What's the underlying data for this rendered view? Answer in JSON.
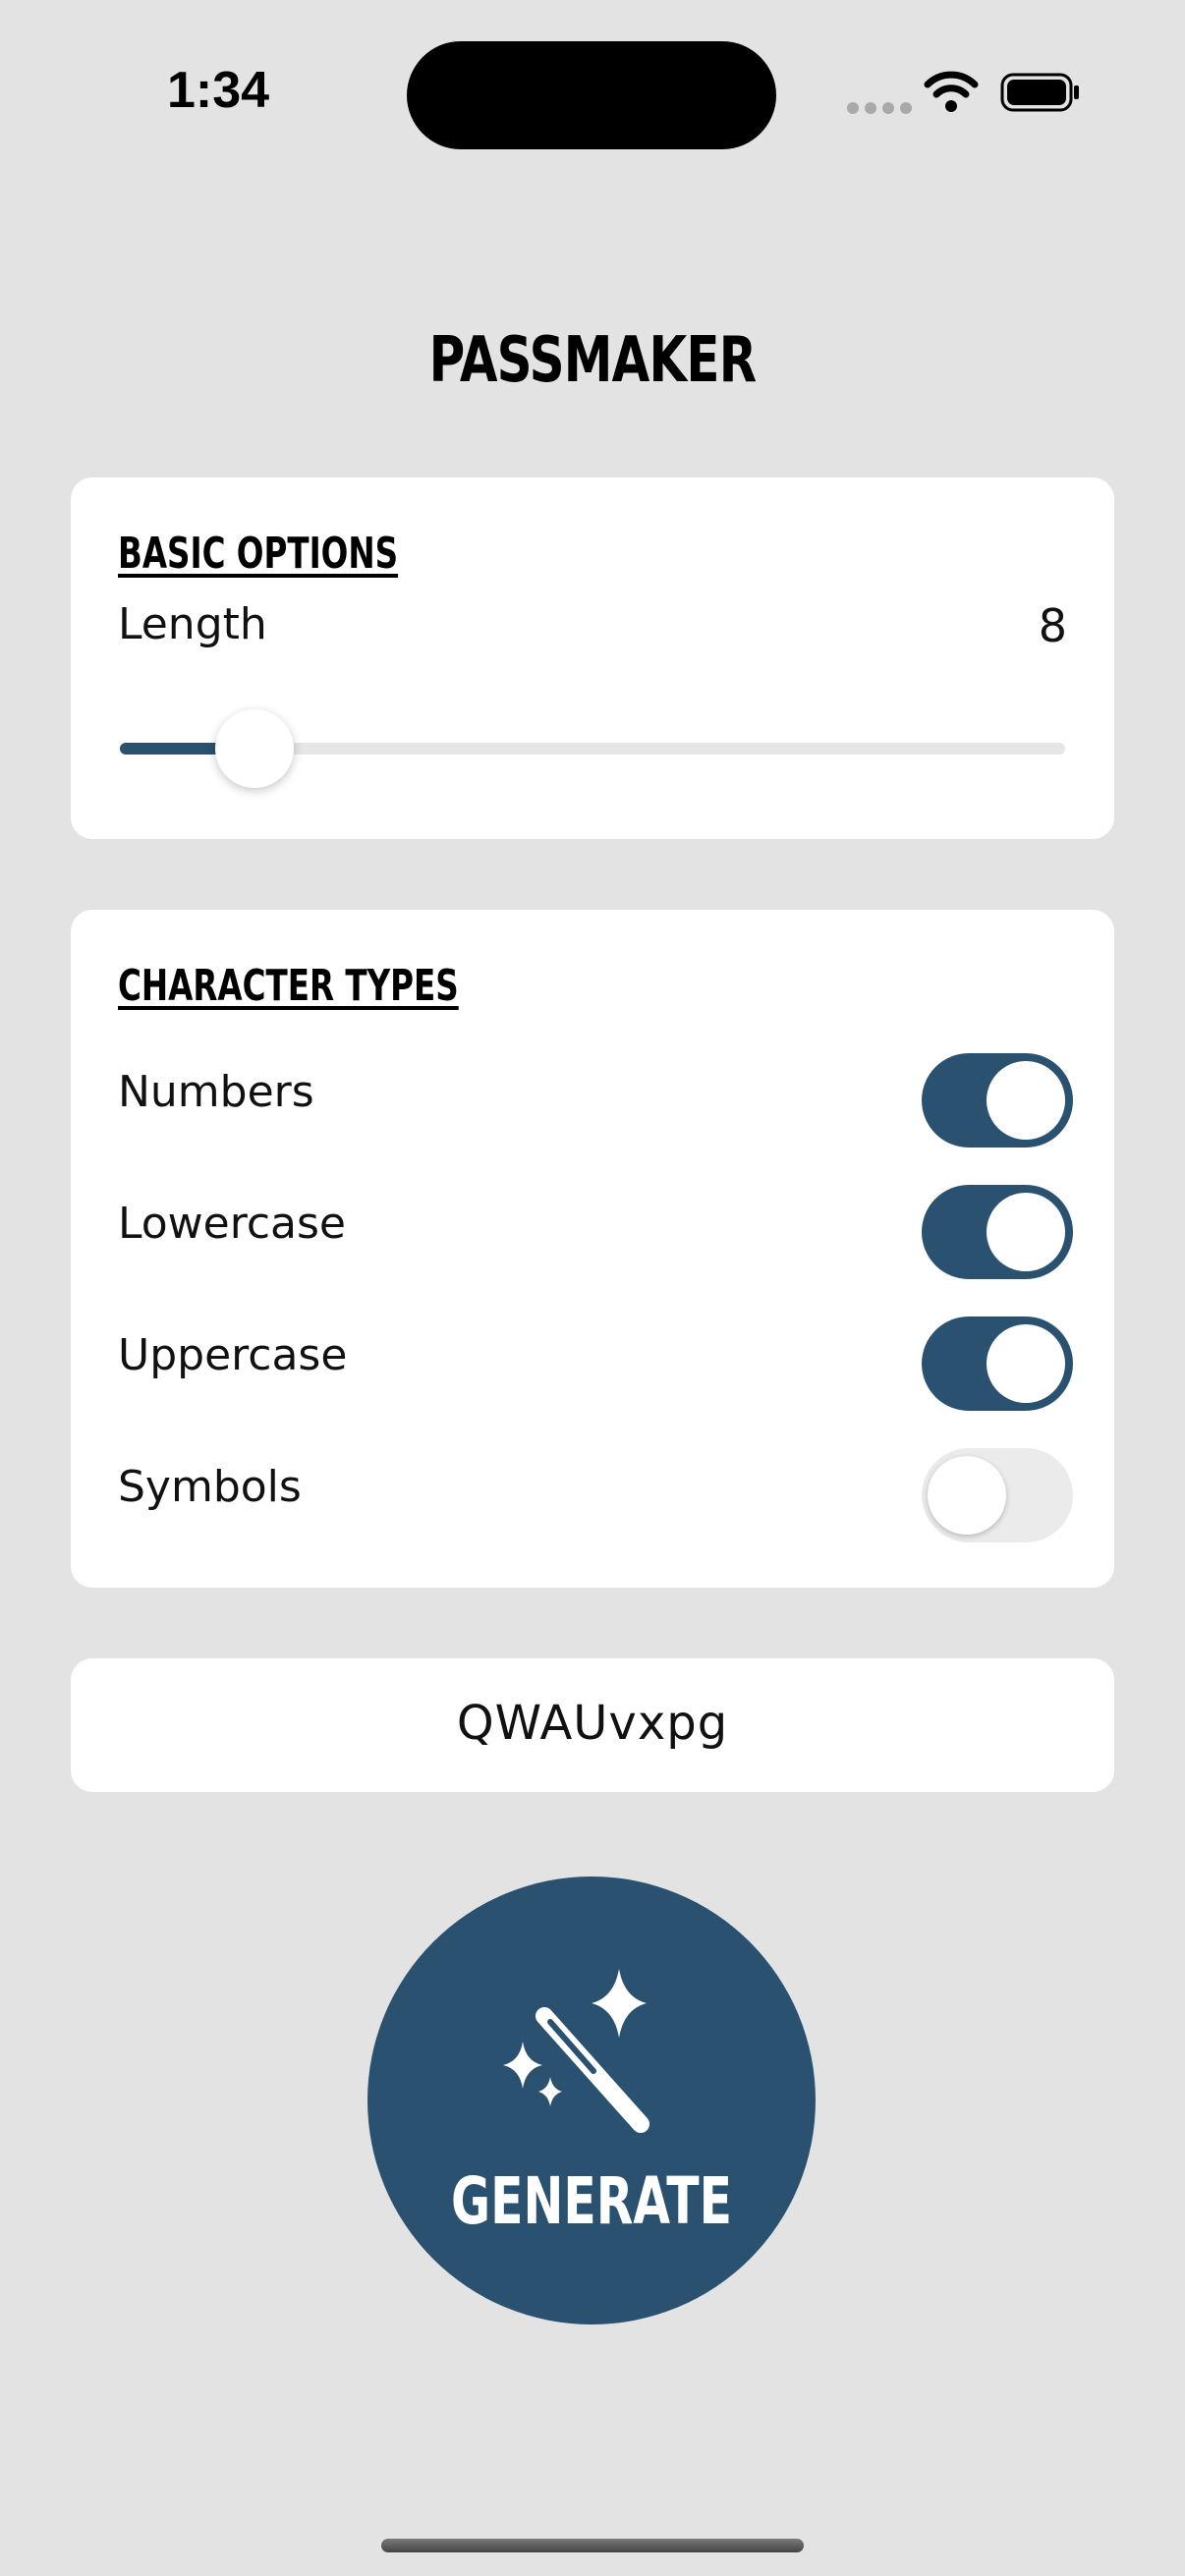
{
  "status_bar": {
    "time": "1:34"
  },
  "app": {
    "title": "PASSMAKER"
  },
  "basic_options": {
    "heading": "BASIC OPTIONS",
    "length_label": "Length",
    "length_value": "8",
    "slider_fraction": 0.142
  },
  "character_types": {
    "heading": "CHARACTER TYPES",
    "items": [
      {
        "label": "Numbers",
        "enabled": true
      },
      {
        "label": "Lowercase",
        "enabled": true
      },
      {
        "label": "Uppercase",
        "enabled": true
      },
      {
        "label": "Symbols",
        "enabled": false
      }
    ]
  },
  "output": {
    "password": "QWAUvxpg"
  },
  "generate_button": {
    "label": "GENERATE",
    "icon": "magic-wand-icon"
  },
  "colors": {
    "accent": "#2b5170",
    "background": "#e3e3e3",
    "card": "#ffffff"
  }
}
